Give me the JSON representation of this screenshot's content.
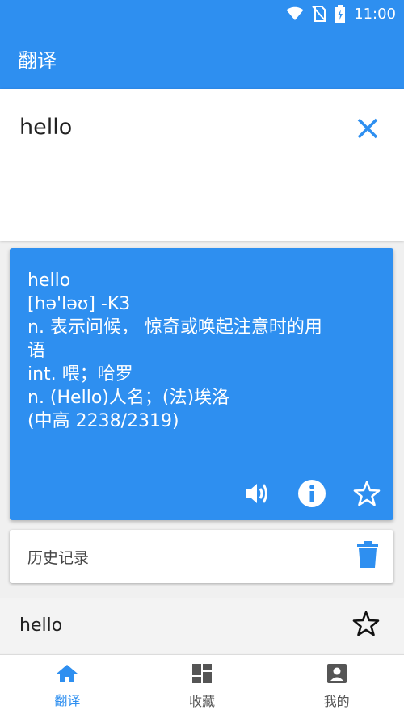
{
  "status_bar": {
    "time": "11:00",
    "icons": [
      "wifi-icon",
      "no-sim-icon",
      "battery-charging-icon"
    ]
  },
  "app_bar": {
    "title": "翻译"
  },
  "input": {
    "value": "hello",
    "clear_icon": "close-icon"
  },
  "result": {
    "lines": [
      "hello",
      "[hə'ləʊ] -K3",
      "n. 表示问候， 惊奇或唤起注意时的用",
      "语",
      "int. 喂；哈罗",
      "n. (Hello)人名；(法)埃洛",
      "(中高 2238/2319)"
    ],
    "actions": [
      "speaker-icon",
      "info-icon",
      "star-outline-icon"
    ]
  },
  "history": {
    "label": "历史记录",
    "delete_icon": "trash-icon",
    "items": [
      {
        "word": "hello",
        "icon": "star-outline-icon"
      }
    ]
  },
  "bottom_nav": {
    "items": [
      {
        "label": "翻译",
        "icon": "home-icon",
        "active": true
      },
      {
        "label": "收藏",
        "icon": "dashboard-icon",
        "active": false
      },
      {
        "label": "我的",
        "icon": "account-box-icon",
        "active": false
      }
    ]
  },
  "colors": {
    "primary": "#2e8ff0",
    "nav_active": "#2e8ff0",
    "nav_inactive": "#555555"
  }
}
